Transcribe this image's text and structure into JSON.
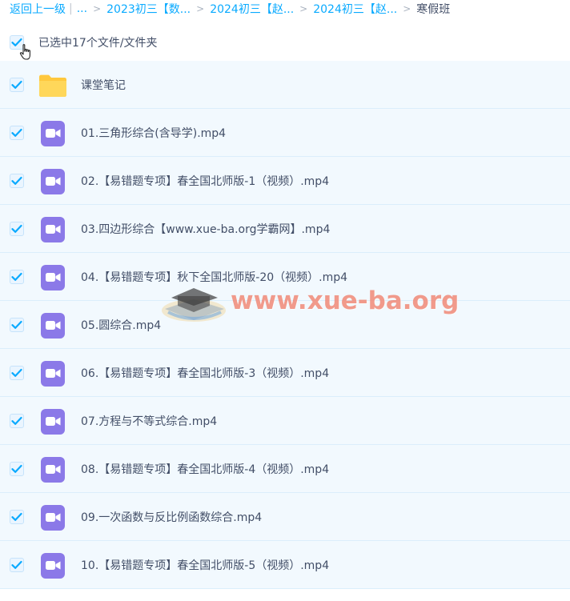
{
  "breadcrumb": {
    "back_label": "返回上一级",
    "separator": "|",
    "ellipsis": "...",
    "items": [
      "2023初三【数...",
      "2024初三【赵...",
      "2024初三【赵..."
    ],
    "current": "寒假班"
  },
  "select_all": {
    "label": "已选中17个文件/文件夹",
    "checked": true
  },
  "files": [
    {
      "name": "课堂笔记",
      "type": "folder",
      "checked": true
    },
    {
      "name": "01.三角形综合(含导学).mp4",
      "type": "video",
      "checked": true
    },
    {
      "name": "02.【易错题专项】春全国北师版-1（视频）.mp4",
      "type": "video",
      "checked": true
    },
    {
      "name": "03.四边形综合【www.xue-ba.org学霸网】.mp4",
      "type": "video",
      "checked": true
    },
    {
      "name": "04.【易错题专项】秋下全国北师版-20（视频）.mp4",
      "type": "video",
      "checked": true
    },
    {
      "name": "05.圆综合.mp4",
      "type": "video",
      "checked": true
    },
    {
      "name": "06.【易错题专项】春全国北师版-3（视频）.mp4",
      "type": "video",
      "checked": true
    },
    {
      "name": "07.方程与不等式综合.mp4",
      "type": "video",
      "checked": true
    },
    {
      "name": "08.【易错题专项】春全国北师版-4（视频）.mp4",
      "type": "video",
      "checked": true
    },
    {
      "name": "09.一次函数与反比例函数综合.mp4",
      "type": "video",
      "checked": true
    },
    {
      "name": "10.【易错题专项】春全国北师版-5（视频）.mp4",
      "type": "video",
      "checked": true
    }
  ],
  "watermark": {
    "text": "www.xue-ba.org"
  },
  "colors": {
    "link": "#09aaff",
    "row_bg": "#f2f9fe",
    "check": "#09aaff",
    "folder": "#ffd24d",
    "video": "#8b79e8"
  },
  "icons": {
    "folder": "folder-icon",
    "video": "video-file-icon",
    "check": "checkbox-icon",
    "cursor": "hand-cursor-icon"
  }
}
